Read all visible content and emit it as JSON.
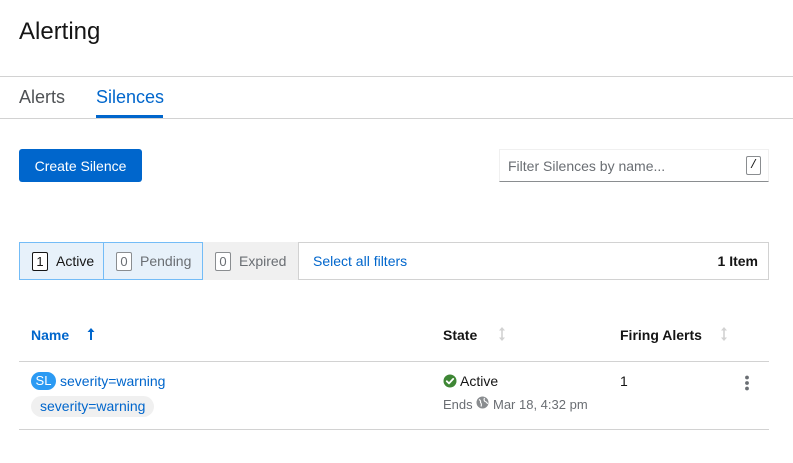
{
  "page": {
    "title": "Alerting"
  },
  "tabs": [
    {
      "label": "Alerts",
      "active": false
    },
    {
      "label": "Silences",
      "active": true
    }
  ],
  "toolbar": {
    "create_label": "Create Silence",
    "filter_placeholder": "Filter Silences by name...",
    "filter_value": "",
    "shortcut_hint": "/"
  },
  "filters": {
    "chips": [
      {
        "count": "1",
        "label": "Active",
        "selected": true
      },
      {
        "count": "0",
        "label": "Pending",
        "selected": true
      },
      {
        "count": "0",
        "label": "Expired",
        "selected": false
      }
    ],
    "select_all_label": "Select all filters",
    "item_count": "1 Item"
  },
  "table": {
    "columns": [
      {
        "label": "Name",
        "sorted": "ascending"
      },
      {
        "label": "State",
        "sorted": "none"
      },
      {
        "label": "Firing Alerts",
        "sorted": "none"
      }
    ],
    "rows": [
      {
        "badge": "SL",
        "name": "severity=warning",
        "matcher": "severity=warning",
        "state": "Active",
        "ends_label": "Ends",
        "ends_time": "Mar 18, 4:32 pm",
        "firing_alerts": "1"
      }
    ]
  },
  "colors": {
    "accent": "#0066cc",
    "success": "#3e8635",
    "badge_sl": "#2b9af3",
    "chip_selected_bg": "#e7f1fa"
  },
  "icons": [
    "sort-ascending-icon",
    "sort-icon",
    "check-circle-icon",
    "globe-icon",
    "kebab-icon"
  ]
}
